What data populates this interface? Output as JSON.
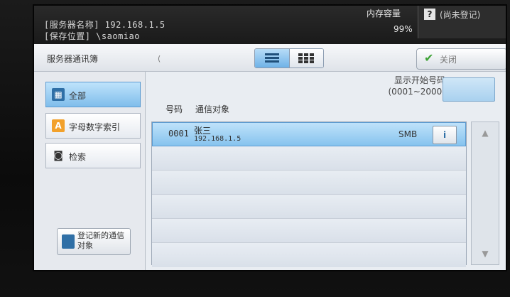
{
  "status": {
    "server_name_line": "[服务器名称] 192.168.1.5",
    "save_location_line": "[保存位置] \\saomiao",
    "memory_label": "内存容量",
    "memory_value": "99%",
    "job_text": "(尚未登记)"
  },
  "header": {
    "title": "服务器通讯簿",
    "title_sep": "(",
    "apply_label": "关闭"
  },
  "sidebar": {
    "items": [
      {
        "label": "全部",
        "icon": "all-icon"
      },
      {
        "label": "字母数字索引",
        "icon": "alpha-index-icon"
      },
      {
        "label": "检索",
        "icon": "binoculars-icon"
      }
    ],
    "register_label": "登记新的通信对象"
  },
  "main": {
    "start_number_label": "显示开始号码",
    "start_number_range": "(0001~2000)",
    "columns": {
      "number": "号码",
      "target": "通信对象"
    },
    "rows": [
      {
        "number": "0001",
        "name": "张三",
        "address": "192.168.1.5",
        "protocol": "SMB"
      }
    ]
  }
}
